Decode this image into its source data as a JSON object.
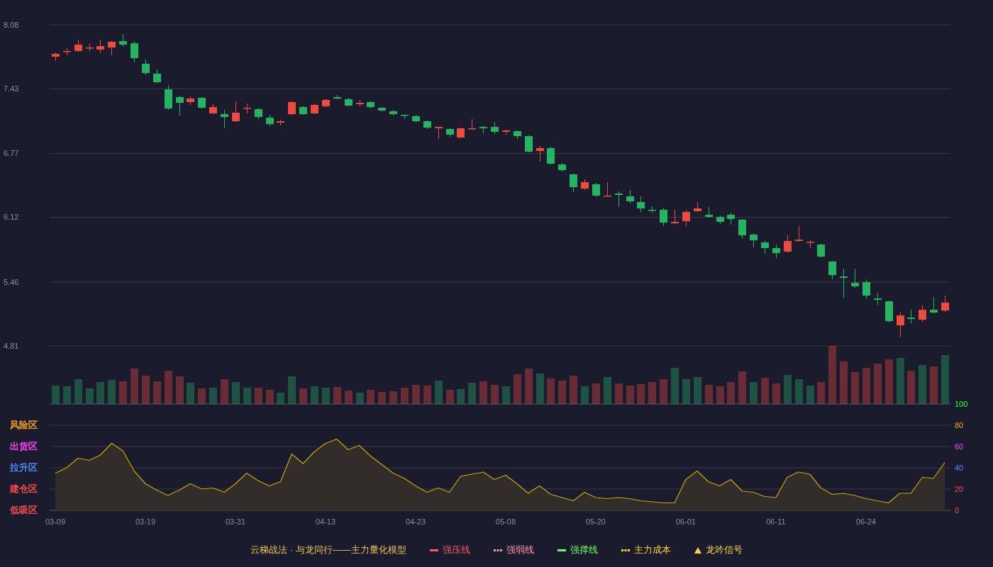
{
  "price_panel": {
    "chart_data": {
      "type": "candlestick",
      "categories": [
        null,
        null,
        null,
        null,
        null,
        null,
        null,
        null,
        null,
        null,
        null,
        null,
        null,
        null,
        null,
        null,
        null,
        null,
        null,
        null,
        null,
        null,
        null,
        null,
        null,
        null,
        null,
        null,
        null,
        null,
        null,
        null,
        null,
        null,
        null,
        null,
        null,
        null,
        null,
        null,
        null,
        null,
        null,
        null,
        null,
        null,
        null,
        null,
        null,
        null,
        null,
        null,
        null,
        null,
        null,
        null,
        null,
        null,
        null,
        null,
        null,
        null,
        null,
        null,
        null,
        null,
        null,
        null,
        null,
        null,
        null,
        null,
        null,
        null,
        null,
        null,
        null,
        null,
        null,
        null
      ],
      "ohlc": [
        [
          7.755,
          7.798,
          7.712,
          7.784
        ],
        [
          7.806,
          7.842,
          7.77,
          7.813
        ],
        [
          7.813,
          7.928,
          7.806,
          7.878
        ],
        [
          7.842,
          7.885,
          7.813,
          7.849
        ],
        [
          7.827,
          7.928,
          7.791,
          7.863
        ],
        [
          7.849,
          7.914,
          7.77,
          7.907
        ],
        [
          7.914,
          7.986,
          7.856,
          7.878
        ],
        [
          7.892,
          7.914,
          7.697,
          7.741
        ],
        [
          7.683,
          7.726,
          7.567,
          7.589
        ],
        [
          7.582,
          7.625,
          7.488,
          7.495
        ],
        [
          7.423,
          7.466,
          7.214,
          7.228
        ],
        [
          7.344,
          7.358,
          7.156,
          7.286
        ],
        [
          7.293,
          7.351,
          7.264,
          7.329
        ],
        [
          7.336,
          7.344,
          7.228,
          7.235
        ],
        [
          7.178,
          7.271,
          7.17,
          7.242
        ],
        [
          7.17,
          7.214,
          7.026,
          7.141
        ],
        [
          7.098,
          7.3,
          7.091,
          7.185
        ],
        [
          7.228,
          7.279,
          7.178,
          7.235
        ],
        [
          7.221,
          7.235,
          7.12,
          7.141
        ],
        [
          7.134,
          7.163,
          7.048,
          7.069
        ],
        [
          7.084,
          7.113,
          7.055,
          7.098
        ],
        [
          7.17,
          7.3,
          7.163,
          7.293
        ],
        [
          7.242,
          7.25,
          7.163,
          7.17
        ],
        [
          7.178,
          7.279,
          7.17,
          7.264
        ],
        [
          7.25,
          7.322,
          7.242,
          7.315
        ],
        [
          7.344,
          7.365,
          7.322,
          7.329
        ],
        [
          7.322,
          7.336,
          7.25,
          7.257
        ],
        [
          7.271,
          7.315,
          7.25,
          7.286
        ],
        [
          7.293,
          7.3,
          7.228,
          7.242
        ],
        [
          7.235,
          7.242,
          7.199,
          7.206
        ],
        [
          7.199,
          7.214,
          7.156,
          7.17
        ],
        [
          7.163,
          7.17,
          7.12,
          7.156
        ],
        [
          7.149,
          7.163,
          7.084,
          7.098
        ],
        [
          7.098,
          7.105,
          7.019,
          7.033
        ],
        [
          7.026,
          7.04,
          6.918,
          7.04
        ],
        [
          7.019,
          7.026,
          6.939,
          6.961
        ],
        [
          6.932,
          7.033,
          6.925,
          7.026
        ],
        [
          7.019,
          7.12,
          7.011,
          7.026
        ],
        [
          7.04,
          7.048,
          6.975,
          7.026
        ],
        [
          7.04,
          7.091,
          6.968,
          6.99
        ],
        [
          6.99,
          7.011,
          6.961,
          7.004
        ],
        [
          6.997,
          7.004,
          6.918,
          6.946
        ],
        [
          6.946,
          6.954,
          6.78,
          6.788
        ],
        [
          6.795,
          6.845,
          6.687,
          6.824
        ],
        [
          6.824,
          6.838,
          6.658,
          6.665
        ],
        [
          6.658,
          6.672,
          6.585,
          6.6
        ],
        [
          6.557,
          6.564,
          6.376,
          6.427
        ],
        [
          6.412,
          6.506,
          6.398,
          6.477
        ],
        [
          6.456,
          6.47,
          6.326,
          6.34
        ],
        [
          6.333,
          6.477,
          6.333,
          6.34
        ],
        [
          6.362,
          6.383,
          6.224,
          6.347
        ],
        [
          6.333,
          6.398,
          6.261,
          6.282
        ],
        [
          6.275,
          6.333,
          6.174,
          6.21
        ],
        [
          6.196,
          6.232,
          6.167,
          6.188
        ],
        [
          6.196,
          6.217,
          6.03,
          6.066
        ],
        [
          6.058,
          6.196,
          6.051,
          6.073
        ],
        [
          6.08,
          6.196,
          6.03,
          6.174
        ],
        [
          6.181,
          6.275,
          6.174,
          6.21
        ],
        [
          6.145,
          6.224,
          6.116,
          6.123
        ],
        [
          6.123,
          6.138,
          6.051,
          6.073
        ],
        [
          6.145,
          6.167,
          6.044,
          6.102
        ],
        [
          6.095,
          6.102,
          5.9,
          5.936
        ],
        [
          5.943,
          5.957,
          5.813,
          5.885
        ],
        [
          5.863,
          5.878,
          5.748,
          5.806
        ],
        [
          5.806,
          5.842,
          5.705,
          5.755
        ],
        [
          5.77,
          5.936,
          5.762,
          5.878
        ],
        [
          5.878,
          6.03,
          5.871,
          5.892
        ],
        [
          5.863,
          5.885,
          5.806,
          5.871
        ],
        [
          5.842,
          5.849,
          5.712,
          5.719
        ],
        [
          5.669,
          5.676,
          5.488,
          5.531
        ],
        [
          5.517,
          5.596,
          5.3,
          5.502
        ],
        [
          5.452,
          5.596,
          5.401,
          5.416
        ],
        [
          5.459,
          5.488,
          5.293,
          5.322
        ],
        [
          5.293,
          5.351,
          5.228,
          5.279
        ],
        [
          5.264,
          5.271,
          5.048,
          5.062
        ],
        [
          5.019,
          5.156,
          4.896,
          5.12
        ],
        [
          5.098,
          5.178,
          5.04,
          5.084
        ],
        [
          5.076,
          5.221,
          5.055,
          5.178
        ],
        [
          5.178,
          5.308,
          5.141,
          5.149
        ],
        [
          5.17,
          5.322,
          5.156,
          5.25
        ]
      ],
      "ylim": [
        4.81,
        8.08
      ],
      "yticks": [
        8.08,
        7.43,
        6.77,
        6.12,
        5.46,
        4.81
      ],
      "grid": true
    }
  },
  "indicator_panel": {
    "zones": [
      {
        "label": "风险区",
        "color": "#ffa31a"
      },
      {
        "label": "出货区",
        "color": "#ff44ff"
      },
      {
        "label": "拉升区",
        "color": "#4d8cff"
      },
      {
        "label": "建仓区",
        "color": "#ff4d4d"
      },
      {
        "label": "低吸区",
        "color": "#ff4d4d"
      }
    ],
    "chart_data": {
      "type": "area",
      "categories": [
        "03-09",
        null,
        null,
        null,
        null,
        null,
        null,
        null,
        "03-19",
        null,
        null,
        null,
        null,
        null,
        null,
        null,
        "03-31",
        null,
        null,
        null,
        null,
        null,
        null,
        null,
        "04-13",
        null,
        null,
        null,
        null,
        null,
        null,
        null,
        "04-23",
        null,
        null,
        null,
        null,
        null,
        null,
        null,
        "05-08",
        null,
        null,
        null,
        null,
        null,
        null,
        null,
        "05-20",
        null,
        null,
        null,
        null,
        null,
        null,
        null,
        "06-01",
        null,
        null,
        null,
        null,
        null,
        null,
        null,
        "06-11",
        null,
        null,
        null,
        null,
        null,
        null,
        null,
        "06-24",
        null,
        null,
        null,
        null,
        null,
        null,
        null
      ],
      "values": [
        35,
        40,
        49,
        47,
        52,
        63,
        56,
        37,
        25,
        19,
        14,
        19,
        25,
        20,
        21,
        17,
        25,
        35,
        28,
        23,
        27,
        53,
        44,
        55,
        63,
        67,
        57,
        61,
        51,
        43,
        35,
        30,
        23,
        17,
        21,
        17,
        32,
        34,
        36,
        29,
        33,
        25,
        16,
        23,
        15,
        12,
        9,
        17,
        12,
        11,
        12,
        11,
        9,
        8,
        7,
        7,
        29,
        37,
        27,
        23,
        29,
        18,
        17,
        13,
        12,
        31,
        36,
        34,
        21,
        15,
        16,
        14,
        11,
        9,
        7,
        16,
        16,
        31,
        30,
        45
      ],
      "ylim": [
        0,
        100
      ],
      "yticks": [
        0,
        20,
        40,
        60,
        80,
        100
      ],
      "grid": true
    }
  },
  "legend": {
    "title": "云梯战法 · 与龙同行——主力量化模型",
    "items": [
      {
        "label": "强压线",
        "color": "#ff5a5a",
        "kind": "solid"
      },
      {
        "label": "强弱线",
        "color": "#ff9aa8",
        "kind": "dashed"
      },
      {
        "label": "强撑线",
        "color": "#6cff6c",
        "kind": "solid"
      },
      {
        "label": "主力成本",
        "color": "#ffd92e",
        "kind": "dashed"
      },
      {
        "label": "龙吟信号",
        "color": "#ffd24a",
        "kind": "triangle"
      }
    ]
  }
}
